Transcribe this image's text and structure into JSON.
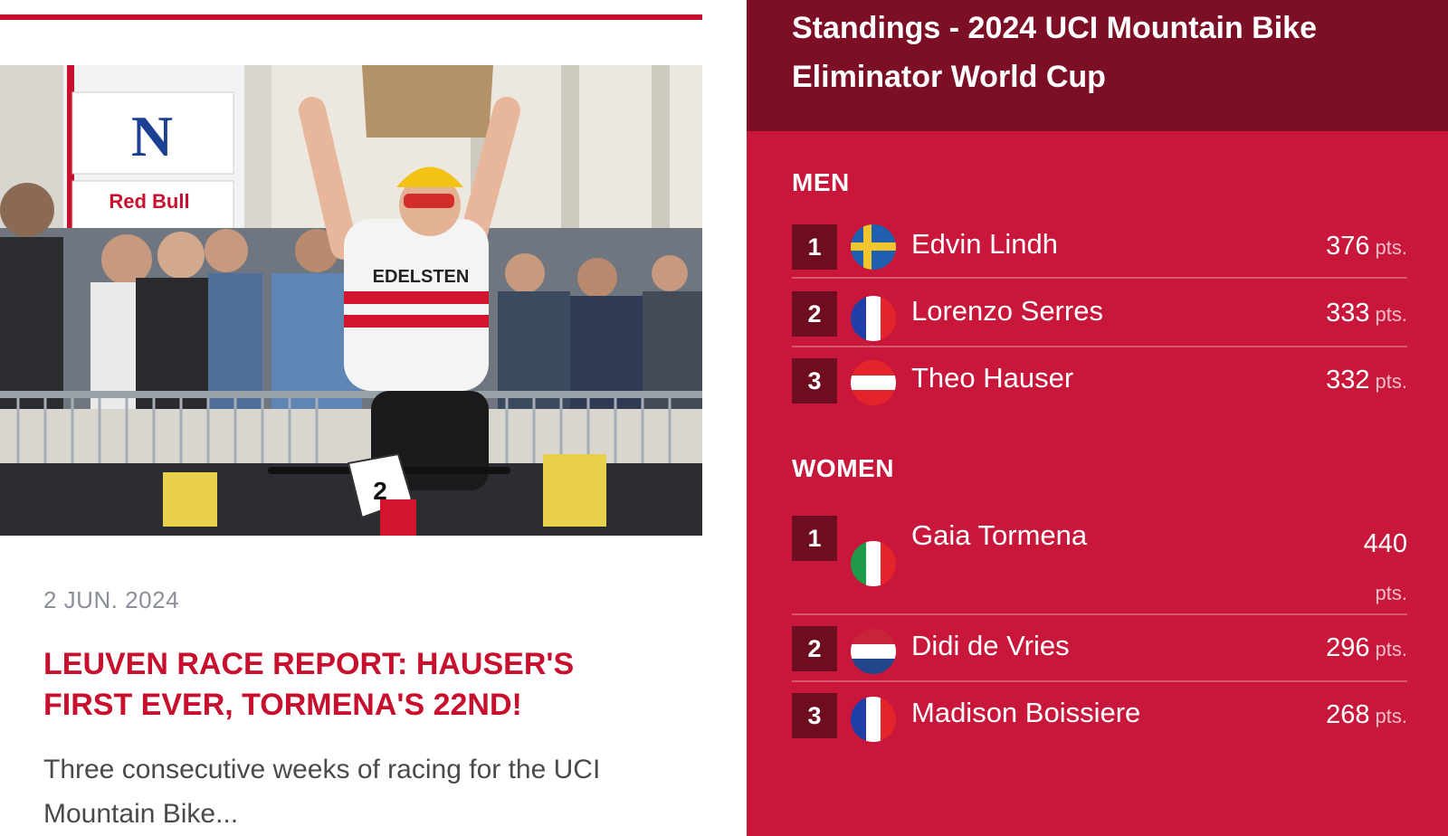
{
  "article": {
    "date": "2 JUN. 2024",
    "headline": "LEUVEN RACE REPORT: HAUSER'S FIRST EVER, TORMENA'S 22ND!",
    "excerpt": "Three consecutive weeks of racing for the UCI Mountain Bike...",
    "hero": {
      "banner_letter": "N",
      "sponsor_text": "Red Bull",
      "jersey_text": "EDELSTEN",
      "plate_number": "2"
    }
  },
  "standings": {
    "title": "Standings - 2024 UCI Mountain Bike Eliminator World Cup",
    "points_unit": "pts.",
    "men": {
      "label": "MEN",
      "entries": [
        {
          "rank": "1",
          "name": "Edvin Lindh",
          "points": "376",
          "flag": "sweden-flag-icon"
        },
        {
          "rank": "2",
          "name": "Lorenzo Serres",
          "points": "333",
          "flag": "france-flag-icon"
        },
        {
          "rank": "3",
          "name": "Theo Hauser",
          "points": "332",
          "flag": "austria-flag-icon"
        }
      ]
    },
    "women": {
      "label": "WOMEN",
      "entries": [
        {
          "rank": "1",
          "name": "Gaia Tormena",
          "points": "440",
          "flag": "italy-flag-icon"
        },
        {
          "rank": "2",
          "name": "Didi de Vries",
          "points": "296",
          "flag": "netherlands-flag-icon"
        },
        {
          "rank": "3",
          "name": "Madison Boissiere",
          "points": "268",
          "flag": "france-flag-icon"
        }
      ]
    }
  },
  "colors": {
    "accent_red": "#c8102e",
    "panel_red": "#c8173a",
    "header_maroon": "#7c0f25",
    "rank_box": "#6e0d20"
  }
}
